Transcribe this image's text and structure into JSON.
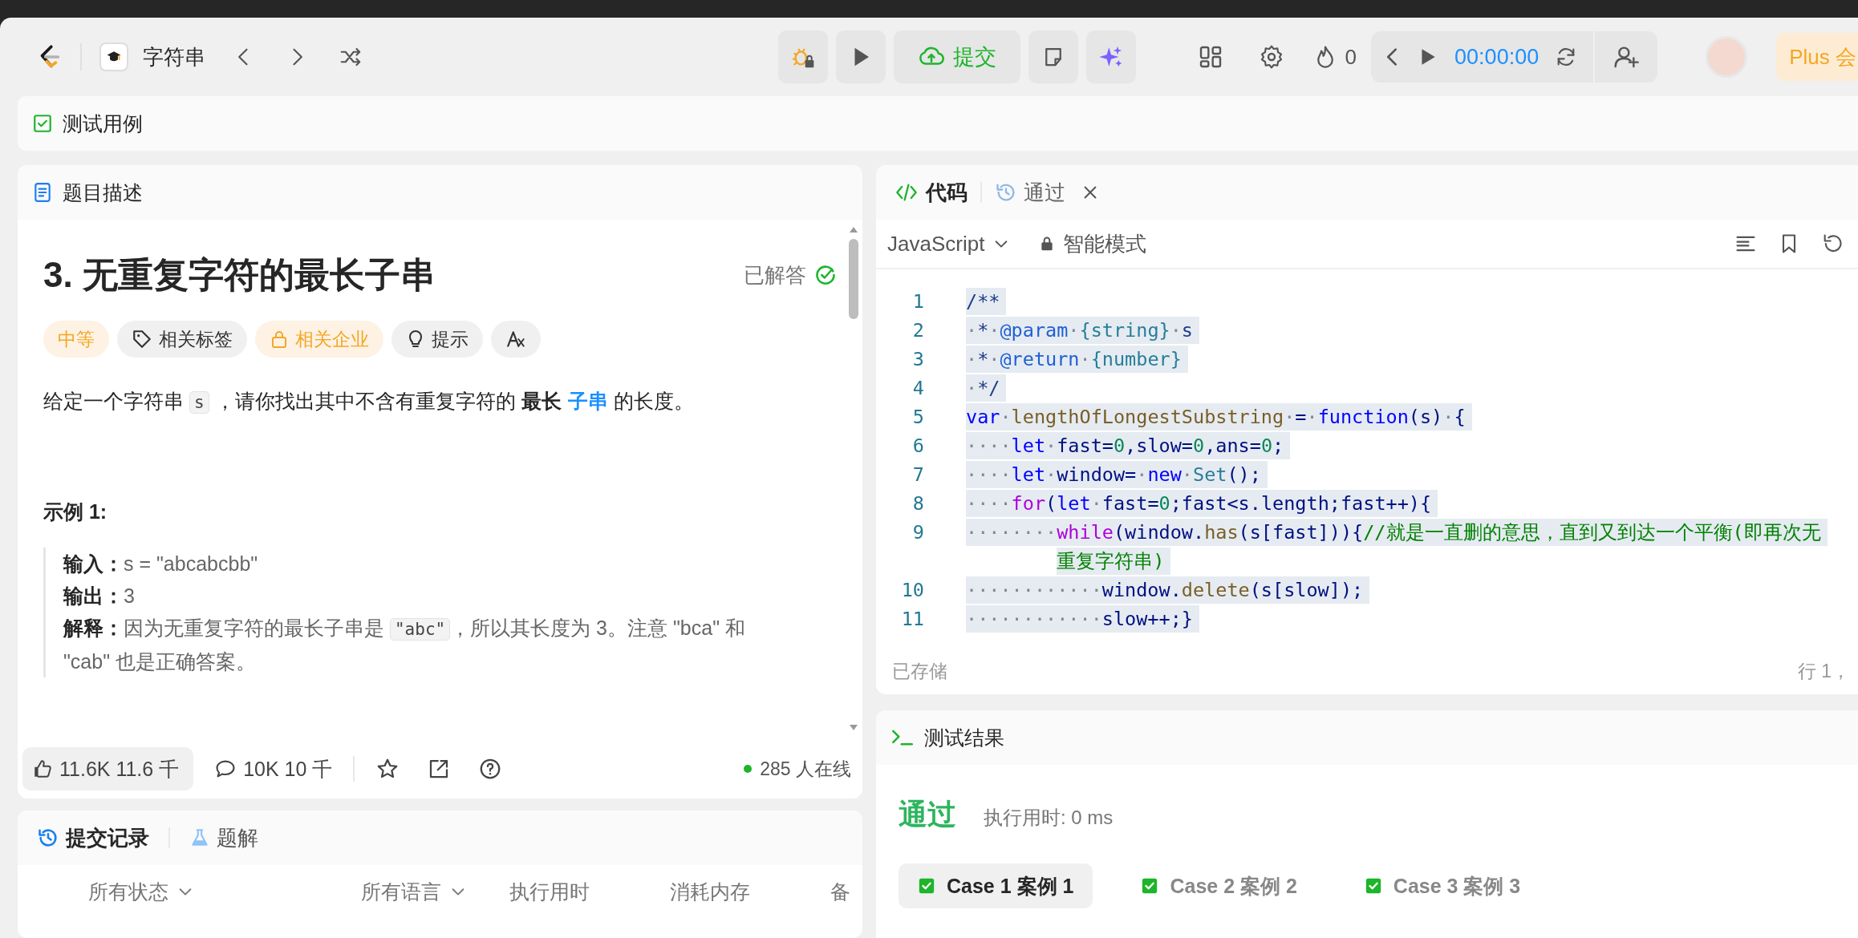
{
  "topbar": {
    "problem_list": "字符串",
    "submit": "提交",
    "streak": "0",
    "timer": "00:00:00",
    "plus": "Plus 会"
  },
  "testcase_bar": {
    "label": "测试用例"
  },
  "description_panel": {
    "tab": "题目描述",
    "title": "3. 无重复字符的最长子串",
    "solved_label": "已解答",
    "tags": [
      {
        "label": "中等",
        "kind": "difficulty"
      },
      {
        "label": "相关标签",
        "kind": "topics"
      },
      {
        "label": "相关企业",
        "kind": "companies"
      },
      {
        "label": "提示",
        "kind": "hint"
      },
      {
        "kind": "translate"
      }
    ],
    "description": [
      {
        "kind": "plain",
        "text": "给定一个字符串 "
      },
      {
        "kind": "code",
        "text": "s"
      },
      {
        "kind": "plain",
        "text": " ，请你找出其中不含有重复字符的 "
      },
      {
        "kind": "bold",
        "text": "最长"
      },
      {
        "kind": "link",
        "text": "子串"
      },
      {
        "kind": "plain",
        "text": " 的长度。"
      }
    ],
    "example": {
      "heading": "示例 1:",
      "lines": [
        {
          "label": "输入：",
          "parts": [
            {
              "kind": "plain",
              "text": "s = \"abcabcbb\""
            }
          ]
        },
        {
          "label": "输出：",
          "parts": [
            {
              "kind": "plain",
              "text": "3"
            }
          ]
        },
        {
          "label": "解释：",
          "parts": [
            {
              "kind": "plain",
              "text": "因为无重复字符的最长子串是 "
            },
            {
              "kind": "code",
              "text": "\"abc\""
            },
            {
              "kind": "plain",
              "text": "，所以其长度为  3。注意 \"bca\"  和  \"cab\"  也是正确答案。"
            }
          ]
        }
      ]
    },
    "footer": {
      "likes": "11.6K  11.6 千",
      "comments": "10K  10 千",
      "online": "285 人在线"
    }
  },
  "submissions_panel": {
    "tabs": [
      {
        "label": "提交记录",
        "kind": "history",
        "selected": true
      },
      {
        "label": "题解",
        "kind": "solutions",
        "selected": false
      }
    ],
    "columns": [
      {
        "label": "所有状态",
        "dropdown": true
      },
      {
        "label": "所有语言",
        "dropdown": true
      },
      {
        "label": "执行用时",
        "dropdown": false
      },
      {
        "label": "消耗内存",
        "dropdown": false
      },
      {
        "label": "备",
        "dropdown": false
      }
    ]
  },
  "code_panel": {
    "tabs": [
      {
        "label": "代码",
        "kind": "code",
        "selected": true,
        "closable": false
      },
      {
        "label": "通过",
        "kind": "result",
        "selected": false,
        "closable": true
      }
    ],
    "language": "JavaScript",
    "mode": "智能模式",
    "lines": [
      {
        "num": "1",
        "tokens": [
          {
            "kind": "doc",
            "text": "/**"
          }
        ]
      },
      {
        "num": "2",
        "tokens": [
          {
            "kind": "ws",
            "text": "·"
          },
          {
            "kind": "doc",
            "text": "*"
          },
          {
            "kind": "ws",
            "text": "·"
          },
          {
            "kind": "tag",
            "text": "@param"
          },
          {
            "kind": "ws",
            "text": "·"
          },
          {
            "kind": "type",
            "text": "{string}"
          },
          {
            "kind": "ws",
            "text": "·"
          },
          {
            "kind": "doc",
            "text": "s"
          }
        ]
      },
      {
        "num": "3",
        "tokens": [
          {
            "kind": "ws",
            "text": "·"
          },
          {
            "kind": "doc",
            "text": "*"
          },
          {
            "kind": "ws",
            "text": "·"
          },
          {
            "kind": "tag",
            "text": "@return"
          },
          {
            "kind": "ws",
            "text": "·"
          },
          {
            "kind": "type",
            "text": "{number}"
          }
        ]
      },
      {
        "num": "4",
        "tokens": [
          {
            "kind": "ws",
            "text": "·"
          },
          {
            "kind": "doc",
            "text": "*/"
          }
        ]
      },
      {
        "num": "5",
        "tokens": [
          {
            "kind": "kw",
            "text": "var"
          },
          {
            "kind": "ws",
            "text": "·"
          },
          {
            "kind": "fn",
            "text": "lengthOfLongestSubstring"
          },
          {
            "kind": "ws",
            "text": "·"
          },
          {
            "kind": "plain",
            "text": "="
          },
          {
            "kind": "ws",
            "text": "·"
          },
          {
            "kind": "kw",
            "text": "function"
          },
          {
            "kind": "plain",
            "text": "(s)"
          },
          {
            "kind": "ws",
            "text": "·"
          },
          {
            "kind": "plain",
            "text": "{"
          }
        ]
      },
      {
        "num": "6",
        "tokens": [
          {
            "kind": "ws",
            "text": "····"
          },
          {
            "kind": "kw",
            "text": "let"
          },
          {
            "kind": "ws",
            "text": "·"
          },
          {
            "kind": "plain",
            "text": "fast="
          },
          {
            "kind": "num",
            "text": "0"
          },
          {
            "kind": "plain",
            "text": ",slow="
          },
          {
            "kind": "num",
            "text": "0"
          },
          {
            "kind": "plain",
            "text": ",ans="
          },
          {
            "kind": "num",
            "text": "0"
          },
          {
            "kind": "plain",
            "text": ";"
          }
        ]
      },
      {
        "num": "7",
        "tokens": [
          {
            "kind": "ws",
            "text": "····"
          },
          {
            "kind": "kw",
            "text": "let"
          },
          {
            "kind": "ws",
            "text": "·"
          },
          {
            "kind": "plain",
            "text": "window="
          },
          {
            "kind": "ws",
            "text": "·"
          },
          {
            "kind": "kw",
            "text": "new"
          },
          {
            "kind": "ws",
            "text": "·"
          },
          {
            "kind": "type",
            "text": "Set"
          },
          {
            "kind": "plain",
            "text": "();"
          }
        ]
      },
      {
        "num": "8",
        "tokens": [
          {
            "kind": "ws",
            "text": "····"
          },
          {
            "kind": "ctrl",
            "text": "for"
          },
          {
            "kind": "plain",
            "text": "("
          },
          {
            "kind": "kw",
            "text": "let"
          },
          {
            "kind": "ws",
            "text": "·"
          },
          {
            "kind": "plain",
            "text": "fast="
          },
          {
            "kind": "num",
            "text": "0"
          },
          {
            "kind": "plain",
            "text": ";fast<s.length;fast++){"
          }
        ]
      },
      {
        "num": "9",
        "tokens": [
          {
            "kind": "ws",
            "text": "········"
          },
          {
            "kind": "ctrl",
            "text": "while"
          },
          {
            "kind": "plain",
            "text": "(window."
          },
          {
            "kind": "fn",
            "text": "has"
          },
          {
            "kind": "plain",
            "text": "(s[fast])){"
          },
          {
            "kind": "com",
            "text": "//就是一直删的意思，直到又到达一个平衡(即再次无"
          }
        ],
        "wrap": [
          {
            "kind": "com",
            "text": "重复字符串)"
          }
        ]
      },
      {
        "num": "10",
        "tokens": [
          {
            "kind": "ws",
            "text": "············"
          },
          {
            "kind": "plain",
            "text": "window."
          },
          {
            "kind": "fn",
            "text": "delete"
          },
          {
            "kind": "plain",
            "text": "(s[slow]);"
          }
        ]
      },
      {
        "num": "11",
        "tokens": [
          {
            "kind": "ws",
            "text": "············"
          },
          {
            "kind": "plain",
            "text": "slow++;}"
          }
        ]
      }
    ],
    "status": "已存储",
    "cursor": "行 1，"
  },
  "result_panel": {
    "title": "测试结果",
    "verdict": "通过",
    "runtime": "执行用时: 0 ms",
    "cases": [
      {
        "label": "Case 1  案例 1",
        "selected": true,
        "passed": true
      },
      {
        "label": "Case 2  案例 2",
        "selected": false,
        "passed": true
      },
      {
        "label": "Case 3  案例 3",
        "selected": false,
        "passed": true
      }
    ]
  }
}
